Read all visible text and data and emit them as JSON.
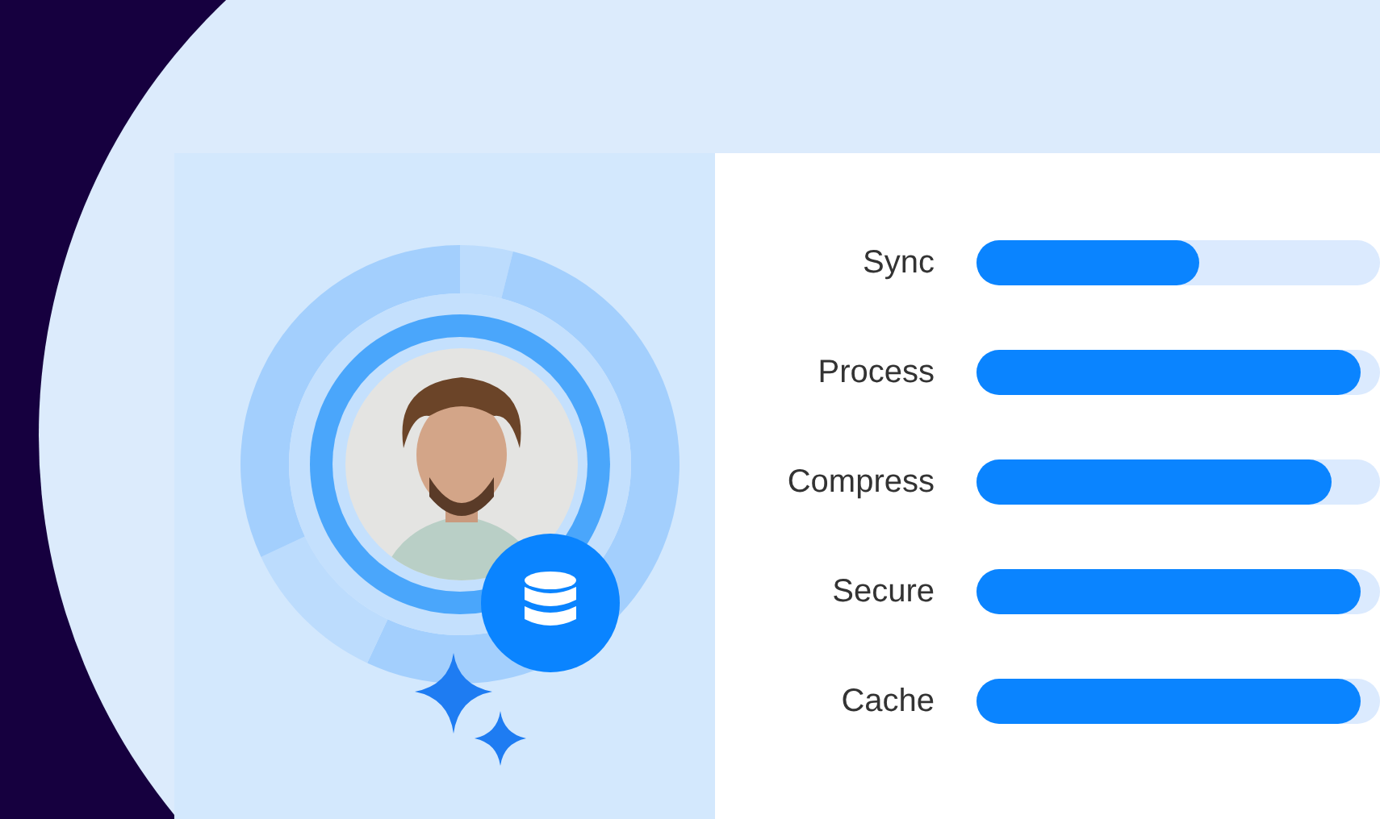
{
  "metrics": [
    {
      "label": "Sync",
      "level": 0.55
    },
    {
      "label": "Process",
      "level": 0.95
    },
    {
      "label": "Compress",
      "level": 0.88
    },
    {
      "label": "Secure",
      "level": 0.95
    },
    {
      "label": "Cache",
      "level": 0.95
    }
  ]
}
